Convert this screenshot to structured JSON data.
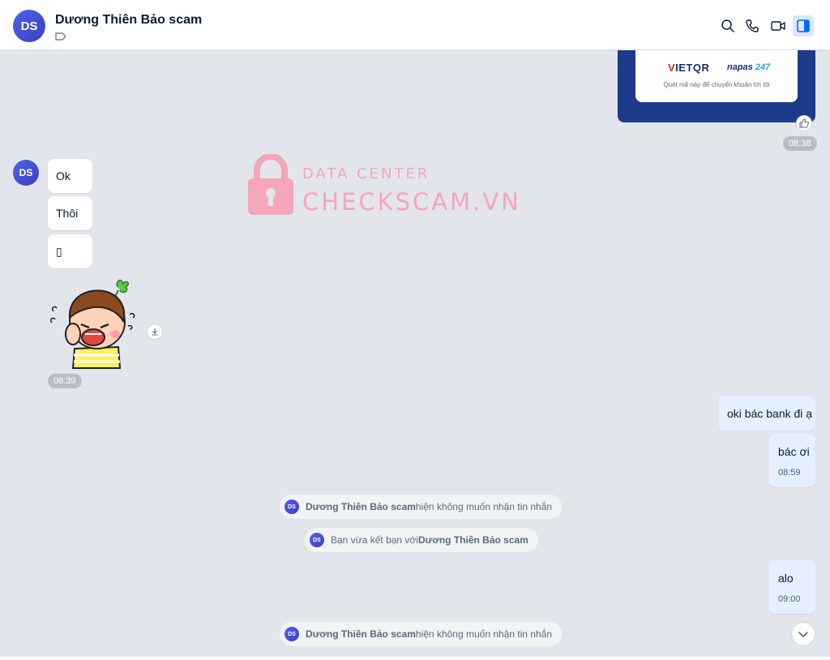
{
  "header": {
    "avatar_initials": "DS",
    "contact_name": "Dương Thiên Bảo scam",
    "icons": [
      "search-icon",
      "phone-icon",
      "video-icon",
      "sidebar-toggle-icon"
    ]
  },
  "watermark": {
    "line1": "DATA CENTER",
    "line2": "CHECKSCAM.VN"
  },
  "qr_card": {
    "brand_left_v": "V",
    "brand_left_rest": "IETQR",
    "brand_right_main": "napas",
    "brand_right_num": " 247",
    "caption": "Quét mã này để chuyển khoản tới tôi",
    "time": "08:38"
  },
  "incoming": {
    "avatar_initials": "DS",
    "messages": [
      "Ok",
      "Thôi",
      "▯"
    ],
    "time": "08:39"
  },
  "outgoing": [
    {
      "text": "oki bác bank đi ạ"
    },
    {
      "text": "bác ơi",
      "time": "08:59"
    },
    {
      "text": "alo",
      "time": "09:00"
    }
  ],
  "system_messages": [
    {
      "initials": "DS",
      "name": "Dương Thiên Bảo scam",
      "rest": " hiện không muốn nhận tin nhắn"
    },
    {
      "initials": "DS",
      "prefix": "Bạn vừa kết bạn với ",
      "name": "Dương Thiên Bảo scam"
    },
    {
      "initials": "DS",
      "name": "Dương Thiên Bảo scam",
      "rest": " hiện không muốn nhận tin nhắn"
    }
  ],
  "colors": {
    "accent": "#0068ff",
    "avatar": "#4f63e8",
    "outgoing_bubble": "#e5efff",
    "watermark": "#f4a6bb"
  }
}
